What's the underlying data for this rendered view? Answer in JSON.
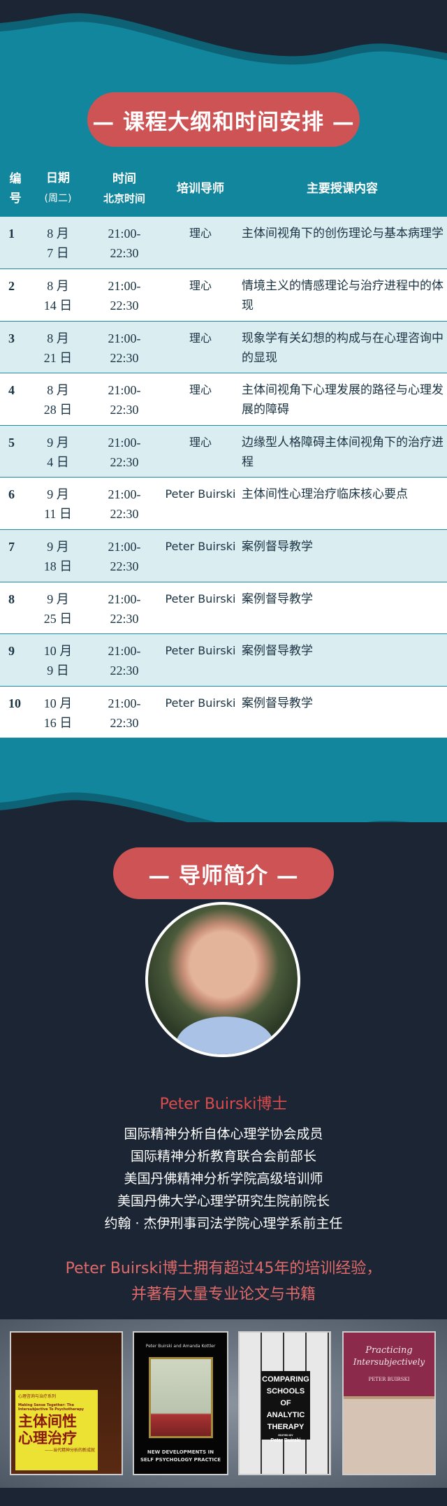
{
  "schedule": {
    "title": "— 课程大纲和时间安排 —",
    "headers": {
      "num": [
        "编",
        "号"
      ],
      "date": [
        "日期",
        "(周二)"
      ],
      "time": [
        "时间",
        "北京时间"
      ],
      "mentor": "培训导师",
      "content": "主要授课内容"
    },
    "rows": [
      {
        "num": "1",
        "month": "8 月",
        "day": "7 日",
        "start": "21:00-",
        "end": "22:30",
        "mentor": "理心",
        "content": "主体间视角下的创伤理论与基本病理学"
      },
      {
        "num": "2",
        "month": "8 月",
        "day": "14 日",
        "start": "21:00-",
        "end": "22:30",
        "mentor": "理心",
        "content": "情境主义的情感理论与治疗进程中的体现"
      },
      {
        "num": "3",
        "month": "8 月",
        "day": "21 日",
        "start": "21:00-",
        "end": "22:30",
        "mentor": "理心",
        "content": "现象学有关幻想的构成与在心理咨询中的显现"
      },
      {
        "num": "4",
        "month": "8 月",
        "day": "28 日",
        "start": "21:00-",
        "end": "22:30",
        "mentor": "理心",
        "content": "主体间视角下心理发展的路径与心理发展的障碍"
      },
      {
        "num": "5",
        "month": "9 月",
        "day": "4 日",
        "start": "21:00-",
        "end": "22:30",
        "mentor": "理心",
        "content": "边缘型人格障碍主体间视角下的治疗进程"
      },
      {
        "num": "6",
        "month": "9 月",
        "day": "11 日",
        "start": "21:00-",
        "end": "22:30",
        "mentor": "Peter Buirski",
        "content": "主体间性心理治疗临床核心要点"
      },
      {
        "num": "7",
        "month": "9 月",
        "day": "18 日",
        "start": "21:00-",
        "end": "22:30",
        "mentor": "Peter Buirski",
        "content": "案例督导教学"
      },
      {
        "num": "8",
        "month": "9 月",
        "day": "25 日",
        "start": "21:00-",
        "end": "22:30",
        "mentor": "Peter Buirski",
        "content": "案例督导教学"
      },
      {
        "num": "9",
        "month": "10 月",
        "day": "9 日",
        "start": "21:00-",
        "end": "22:30",
        "mentor": "Peter Buirski",
        "content": "案例督导教学"
      },
      {
        "num": "10",
        "month": "10 月",
        "day": "16 日",
        "start": "21:00-",
        "end": "22:30",
        "mentor": "Peter Buirski",
        "content": "案例督导教学"
      }
    ]
  },
  "mentor": {
    "title": "— 导师简介 —",
    "name": "Peter Buirski博士",
    "bio": [
      "国际精神分析自体心理学协会成员",
      "国际精神分析教育联合会前部长",
      "美国丹佛精神分析学院高级培训师",
      "美国丹佛大学心理学研究生院前院长",
      "约翰 · 杰伊刑事司法学院心理学系前主任"
    ],
    "highlight": [
      "Peter Buirski博士拥有超过45年的培训经验，",
      "并著有大量专业论文与书籍"
    ]
  },
  "books": [
    {
      "series": "心理咨询与治疗系列",
      "en_title": "Making Sense Together: The Intersubjective To Psychotherapy",
      "title": [
        "主体间性",
        "心理治疗"
      ],
      "subtitle": "——当代精神分析的新成就"
    },
    {
      "editors": "Peter Buirski and Amanda Kottler",
      "title": [
        "NEW DEVELOPMENTS IN",
        "SELF PSYCHOLOGY PRACTICE"
      ]
    },
    {
      "title": [
        "COMPARING",
        "SCHOOLS OF",
        "ANALYTIC",
        "THERAPY"
      ],
      "edited": "EDITED BY",
      "author": "Peter Buirski"
    },
    {
      "title": [
        "Practicing",
        "Intersubjectively"
      ],
      "author": "PETER BUIRSKI"
    }
  ],
  "colors": {
    "teal": "#11869d",
    "dark": "#1b2534",
    "accent": "#cd5354",
    "light_row": "#daeef2",
    "highlight_text": "#e06a6a"
  }
}
